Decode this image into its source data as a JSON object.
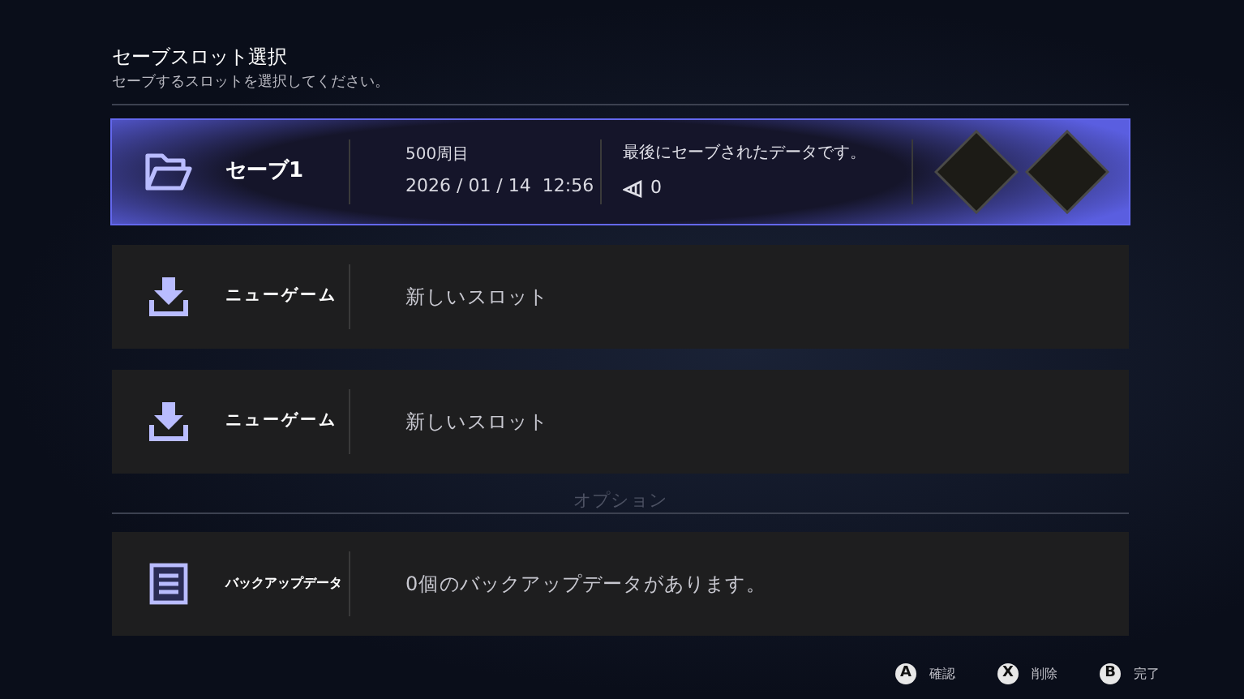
{
  "header": {
    "title": "セーブスロット選択",
    "subtitle": "セーブするスロットを選択してください。"
  },
  "slots": [
    {
      "kind": "save",
      "selected": true,
      "name": "セーブ1",
      "playthrough": "500周目",
      "timestamp": "2026 / 01 / 14  12:56",
      "note": "最後にセーブされたデータです。",
      "count": "0"
    },
    {
      "kind": "new",
      "selected": false,
      "name": "ニューゲーム",
      "description": "新しいスロット"
    },
    {
      "kind": "new",
      "selected": false,
      "name": "ニューゲーム",
      "description": "新しいスロット"
    },
    {
      "kind": "backup",
      "selected": false,
      "name": "バックアップデータ",
      "description": "0個のバックアップデータがあります。"
    }
  ],
  "background_text": "オプション",
  "prompts": [
    {
      "button": "A",
      "label": "確認"
    },
    {
      "button": "X",
      "label": "削除"
    },
    {
      "button": "B",
      "label": "完了"
    }
  ]
}
